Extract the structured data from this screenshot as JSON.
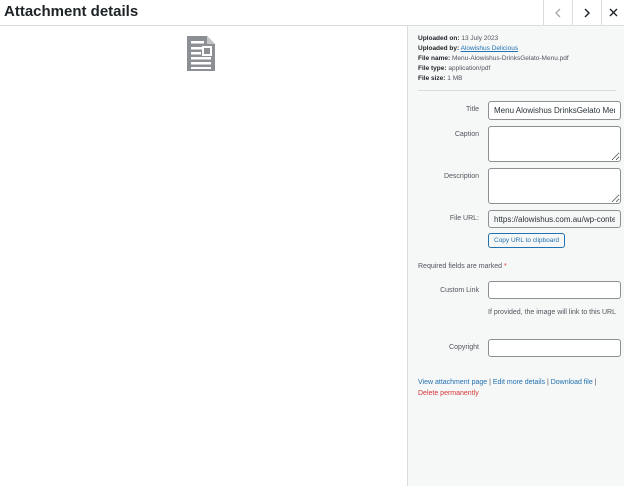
{
  "header": {
    "title": "Attachment details",
    "prev_icon": "chevron-left-icon",
    "next_icon": "chevron-right-icon",
    "close_icon": "close-icon"
  },
  "preview": {
    "icon": "document-icon"
  },
  "meta": {
    "uploaded_on_label": "Uploaded on:",
    "uploaded_on": "13 July 2023",
    "uploaded_by_label": "Uploaded by:",
    "uploaded_by": "Alowishus Delicious",
    "file_name_label": "File name:",
    "file_name": "Menu-Alowishus-DrinksGelato-Menu.pdf",
    "file_type_label": "File type:",
    "file_type": "application/pdf",
    "file_size_label": "File size:",
    "file_size": "1 MB"
  },
  "form": {
    "title_label": "Title",
    "title_value": "Menu Alowishus DrinksGelato Menu",
    "caption_label": "Caption",
    "caption_value": "",
    "description_label": "Description",
    "description_value": "",
    "file_url_label": "File URL:",
    "file_url_value": "https://alowishus.com.au/wp-content/",
    "copy_button": "Copy URL to clipboard",
    "required_note": "Required fields are marked",
    "required_star": "*",
    "custom_link_label": "Custom Link",
    "custom_link_value": "",
    "custom_link_help": "If provided, the image will link to this URL",
    "copyright_label": "Copyright",
    "copyright_value": ""
  },
  "actions": {
    "view": "View attachment page",
    "sep1": " | ",
    "edit": "Edit more details",
    "sep2": " | ",
    "download": "Download file",
    "sep3": " |",
    "delete": "Delete permanently"
  },
  "colors": {
    "link": "#2271b1",
    "danger": "#d63638",
    "sidebar_bg": "#f6f7f7",
    "icon_gray": "#8c8f94"
  }
}
